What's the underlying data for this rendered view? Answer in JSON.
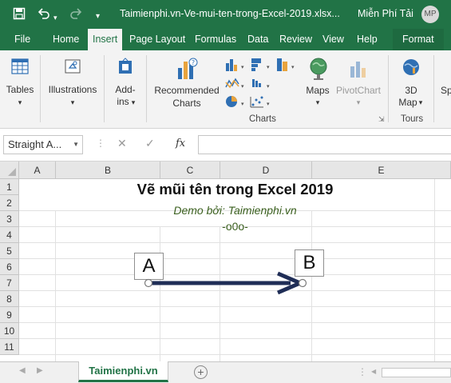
{
  "titlebar": {
    "doc_title": "Taimienphi.vn-Ve-mui-ten-trong-Excel-2019.xlsx...",
    "user_name": "Miễn Phí Tải",
    "user_initials": "MP"
  },
  "tabs": [
    "File",
    "Home",
    "Insert",
    "Page Layout",
    "Formulas",
    "Data",
    "Review",
    "View",
    "Help",
    "Format"
  ],
  "active_tab": "Insert",
  "ribbon": {
    "tables": {
      "label": "Tables",
      "arrow": "▾"
    },
    "illustrations": {
      "label": "Illustrations",
      "arrow": "▾"
    },
    "addins": {
      "label1": "Add-",
      "label2": "ins",
      "arrow": "▾"
    },
    "recommended_charts": {
      "label1": "Recommended",
      "label2": "Charts"
    },
    "maps": {
      "label": "Maps",
      "arrow": "▾"
    },
    "pivotchart": {
      "label": "PivotChart",
      "arrow": "▾"
    },
    "map3d": {
      "label1": "3D",
      "label2": "Map",
      "arrow": "▾"
    },
    "sp": {
      "label": "Sp"
    },
    "charts_group": "Charts",
    "tours_group": "Tours"
  },
  "formula_bar": {
    "name_box": "Straight A...",
    "fx": "fx",
    "value": ""
  },
  "grid": {
    "columns": [
      "A",
      "B",
      "C",
      "D",
      "E"
    ],
    "rows": [
      "1",
      "2",
      "3",
      "4",
      "5",
      "6",
      "7",
      "8",
      "9",
      "10",
      "11"
    ],
    "title_cell": "Vẽ mũi tên trong Excel 2019",
    "demo_cell": "Demo bởi: Taimienphi.vn",
    "ooo_cell": "-o0o-"
  },
  "shapes": {
    "box_a": "A",
    "box_b": "B",
    "arrow_color": "#1f2d56"
  },
  "sheets": {
    "active": "Taimienphi.vn",
    "add": "+"
  },
  "colors": {
    "excel_green": "#217346"
  }
}
